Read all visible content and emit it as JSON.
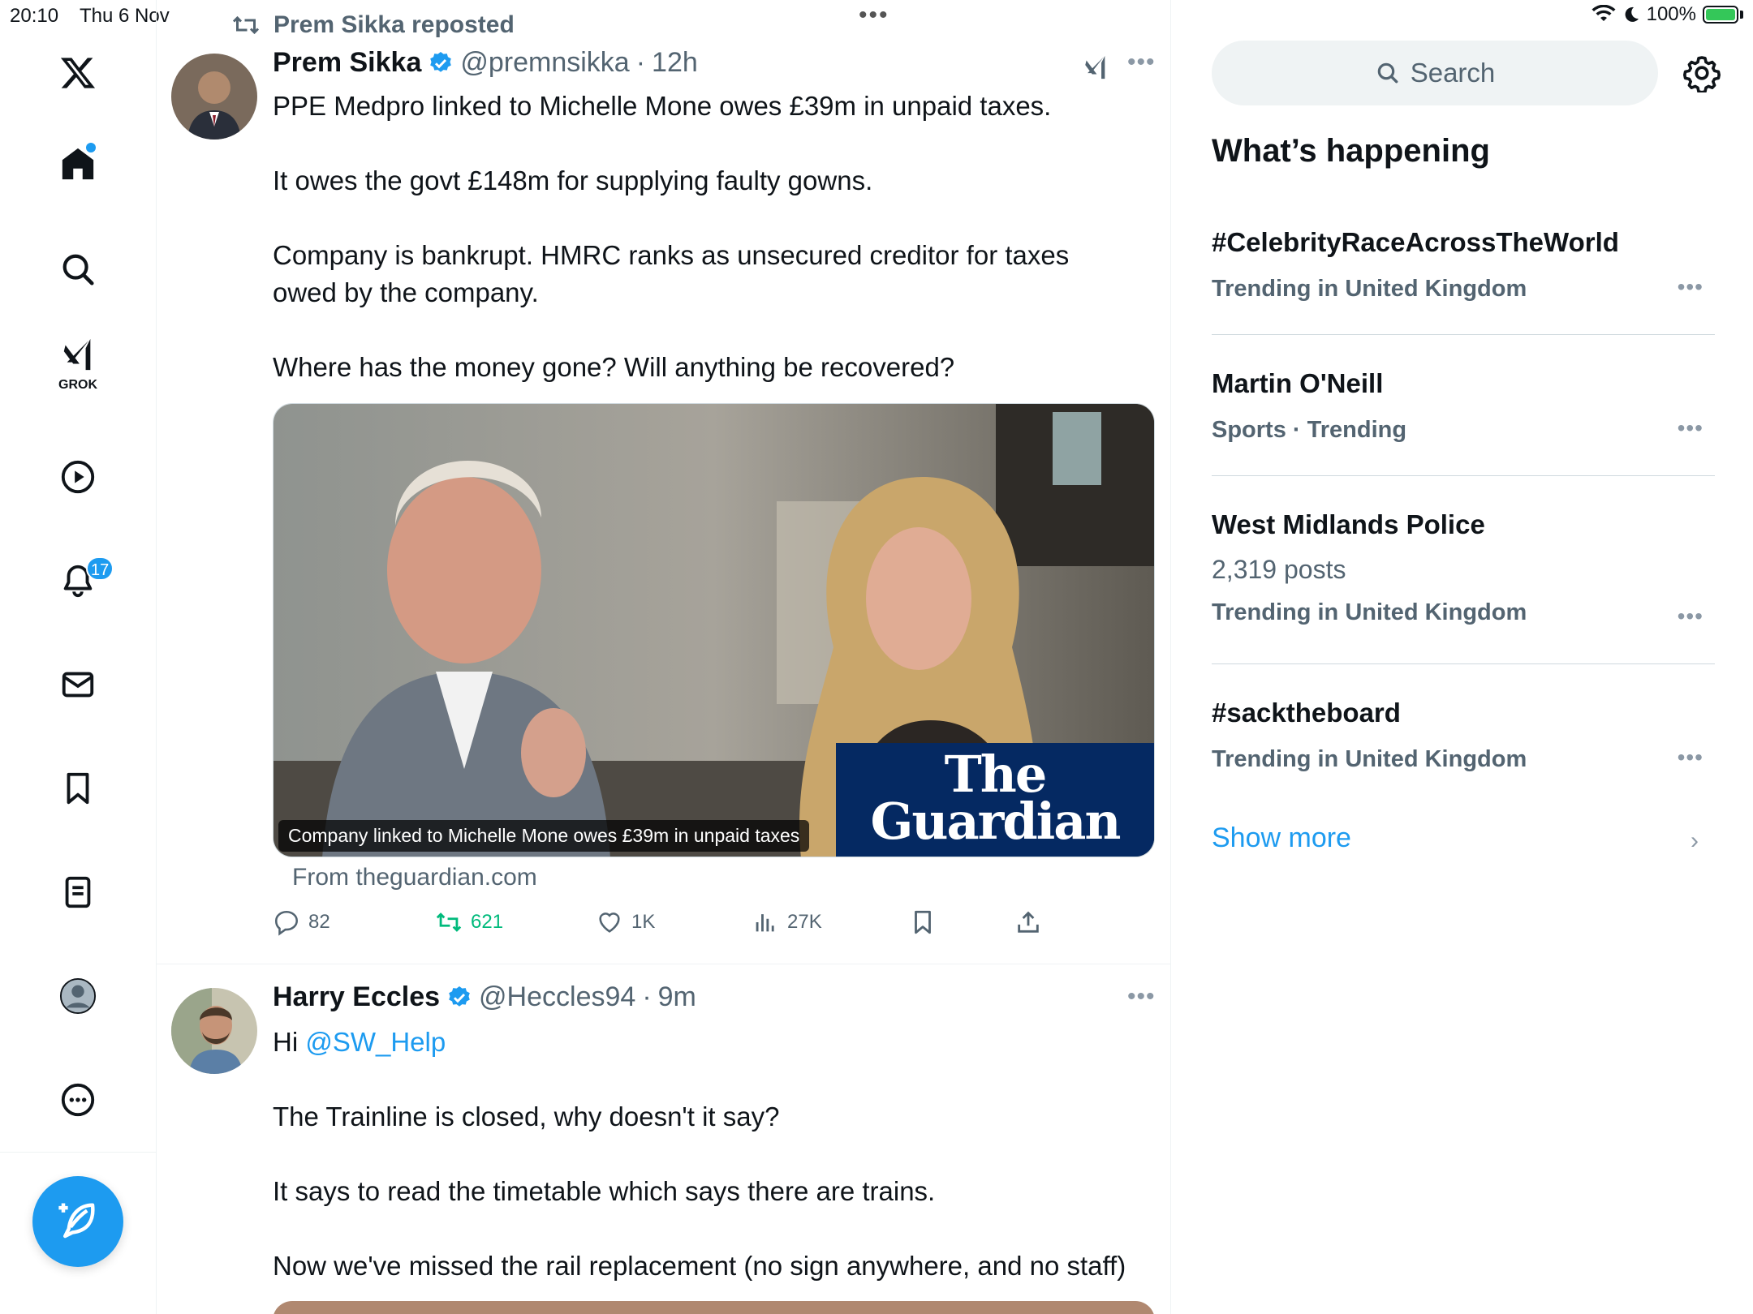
{
  "status_bar": {
    "time": "20:10",
    "date": "Thu 6 Nov",
    "battery": "100%"
  },
  "nav": {
    "notifications_badge": "17",
    "grok_label": "GROK",
    "items": [
      "x-logo",
      "home",
      "explore",
      "grok",
      "video",
      "notifications",
      "messages",
      "bookmarks",
      "lists",
      "profile",
      "more"
    ]
  },
  "feed": {
    "repost_label": "Prem Sikka reposted",
    "tweets": [
      {
        "name": "Prem Sikka",
        "handle": "@premnsikka",
        "time": "12h",
        "paragraphs": [
          "PPE Medpro linked to Michelle Mone owes £39m in unpaid taxes.",
          "It owes the govt £148m for supplying faulty gowns.",
          "Company is bankrupt. HMRC ranks as unsecured creditor for taxes owed by the company.",
          "Where has the money gone? Will anything be recovered?"
        ],
        "media": {
          "caption": "Company linked to Michelle Mone owes £39m in unpaid taxes",
          "logo_line1": "The",
          "logo_line2": "Guardian",
          "source": "From theguardian.com"
        },
        "stats": {
          "replies": "82",
          "reposts": "621",
          "likes": "1K",
          "views": "27K"
        }
      },
      {
        "name": "Harry Eccles",
        "handle": "@Heccles94",
        "time": "9m",
        "greeting": "Hi",
        "mention": "@SW_Help",
        "paragraphs": [
          "The Trainline is closed, why doesn't it say?",
          "It says to read the timetable which says there are trains.",
          "Now we've missed the rail replacement (no sign anywhere, and no staff)"
        ]
      }
    ]
  },
  "sidebar": {
    "search_placeholder": "Search",
    "section_title": "What’s happening",
    "trends": [
      {
        "name": "#CelebrityRaceAcrossTheWorld",
        "context": "Trending in United Kingdom"
      },
      {
        "name": "Martin O'Neill",
        "context": "Sports · Trending"
      },
      {
        "name": "West Midlands Police",
        "posts": "2,319 posts",
        "context": "Trending in United Kingdom"
      },
      {
        "name": "#sacktheboard",
        "context": "Trending in United Kingdom"
      }
    ],
    "show_more": "Show more"
  },
  "colors": {
    "accent": "#1d9bf0",
    "repost_green": "#00ba7c",
    "secondary_text": "#536471",
    "guardian_blue": "#052962"
  }
}
